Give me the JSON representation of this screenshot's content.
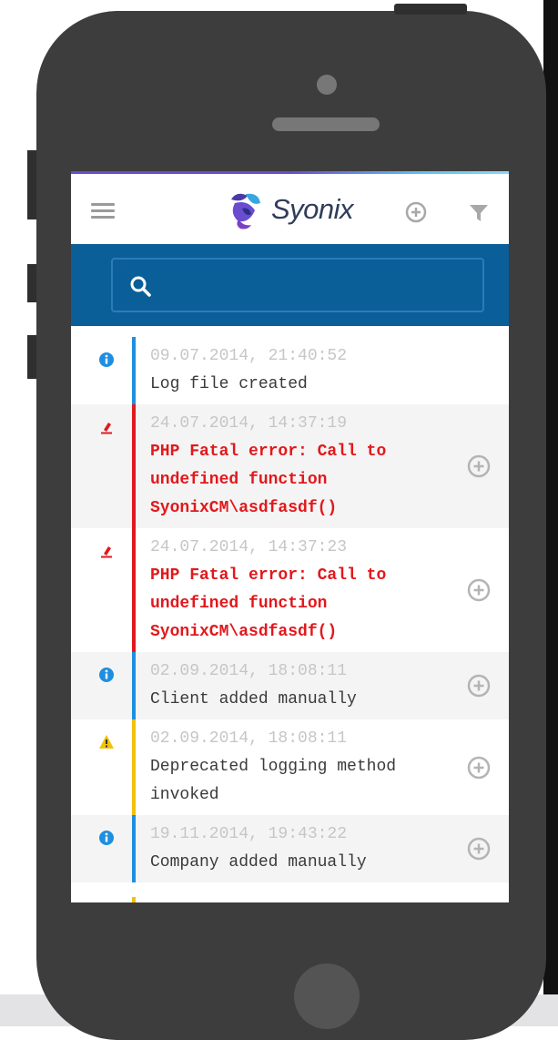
{
  "app": {
    "brand": "Syonix",
    "accent_top": "#6a4ccf",
    "accent_bar": "#0b5f98"
  },
  "header": {
    "menu_icon": "hamburger-icon",
    "add_icon": "plus-circle-icon",
    "filter_icon": "funnel-icon"
  },
  "search": {
    "placeholder": "",
    "value": "",
    "icon": "search-icon"
  },
  "colors": {
    "info": "#1e8fe0",
    "error": "#e2181c",
    "warning": "#f2c20a"
  },
  "logs": [
    {
      "level": "info",
      "timestamp": "09.07.2014, 21:40:52",
      "message": "Log file created",
      "expandable": false
    },
    {
      "level": "error",
      "timestamp": "24.07.2014, 14:37:19",
      "message": "PHP Fatal error: Call to undefined function SyonixCM\\asdfasdf()",
      "expandable": true
    },
    {
      "level": "error",
      "timestamp": "24.07.2014, 14:37:23",
      "message": "PHP Fatal error: Call to undefined function SyonixCM\\asdfasdf()",
      "expandable": true
    },
    {
      "level": "info",
      "timestamp": "02.09.2014, 18:08:11",
      "message": "Client added manually",
      "expandable": true
    },
    {
      "level": "warning",
      "timestamp": "02.09.2014, 18:08:11",
      "message": "Deprecated logging method invoked",
      "expandable": true
    },
    {
      "level": "info",
      "timestamp": "19.11.2014, 19:43:22",
      "message": "Company added manually",
      "expandable": true
    }
  ]
}
